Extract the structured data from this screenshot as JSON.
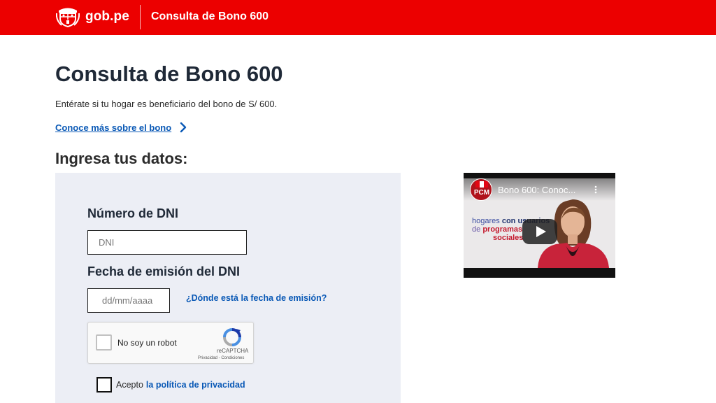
{
  "header": {
    "brand": "gob.pe",
    "title": "Consulta de Bono 600",
    "logo_icon": "peru-coat-of-arms-icon",
    "bar_color": "#ec0000"
  },
  "main": {
    "title": "Consulta de Bono 600",
    "description": "Entérate si tu hogar es beneficiario del bono de S/ 600.",
    "more_link": "Conoce más sobre el bono",
    "section_title": "Ingresa tus datos:"
  },
  "form": {
    "dni_label": "Número de DNI",
    "dni_placeholder": "DNI",
    "dni_value": "",
    "date_label": "Fecha de emisión del DNI",
    "date_placeholder": "dd/mm/aaaa",
    "date_value": "",
    "date_help_link": "¿Dónde está la fecha de emisión?",
    "captcha": {
      "label": "No soy un robot",
      "brand": "reCAPTCHA",
      "terms": "Privacidad - Condiciones",
      "checked": false
    },
    "accept_text": "Acepto",
    "accept_link": "la política de privacidad",
    "accepted": false
  },
  "video": {
    "channel": "PCM",
    "title": "Bono 600: Conoc...",
    "caption_line1": "hogares",
    "caption_line1b": "con usuarios",
    "caption_line2": "de",
    "caption_line2b": "programas",
    "caption_line3": "sociales"
  },
  "colors": {
    "link": "#0a59b6",
    "panel": "#eceef5",
    "text": "#1f2937"
  }
}
